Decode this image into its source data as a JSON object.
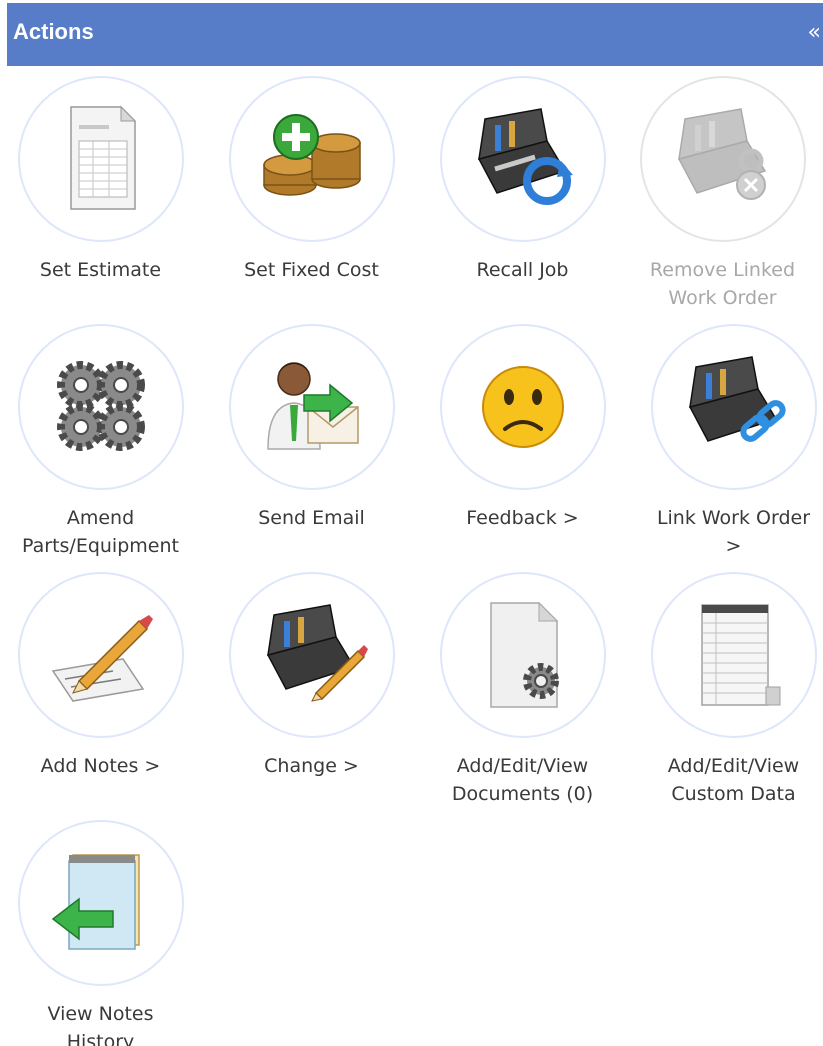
{
  "header": {
    "title": "Actions",
    "collapse_glyph": "«"
  },
  "actions": [
    {
      "label": "Set Estimate",
      "icon": "spreadsheet-document-icon",
      "enabled": true
    },
    {
      "label": "Set Fixed Cost",
      "icon": "coins-add-icon",
      "enabled": true
    },
    {
      "label": "Recall Job",
      "icon": "toolbox-refresh-icon",
      "enabled": true
    },
    {
      "label": "Remove Linked\nWork Order",
      "icon": "toolbox-unlink-icon",
      "enabled": false
    },
    {
      "label": "Amend\nParts/Equipment",
      "icon": "gears-icon",
      "enabled": true
    },
    {
      "label": "Send Email",
      "icon": "person-send-mail-icon",
      "enabled": true
    },
    {
      "label": "Feedback >",
      "icon": "sad-face-icon",
      "enabled": true
    },
    {
      "label": "Link Work Order\n>",
      "icon": "toolbox-link-icon",
      "enabled": true
    },
    {
      "label": "Add Notes >",
      "icon": "pencil-paper-icon",
      "enabled": true
    },
    {
      "label": "Change >",
      "icon": "toolbox-pencil-icon",
      "enabled": true
    },
    {
      "label": "Add/Edit/View\nDocuments (0)",
      "icon": "document-gear-icon",
      "enabled": true
    },
    {
      "label": "Add/Edit/View\nCustom Data",
      "icon": "data-sheet-icon",
      "enabled": true
    },
    {
      "label": "View Notes\nHistory",
      "icon": "notepad-back-arrow-icon",
      "enabled": true
    }
  ],
  "colors": {
    "header_bg": "#577dc9",
    "circle_border": "#dde6fa",
    "label_text": "#3a3a3a",
    "disabled_text": "#a8a8a8"
  }
}
